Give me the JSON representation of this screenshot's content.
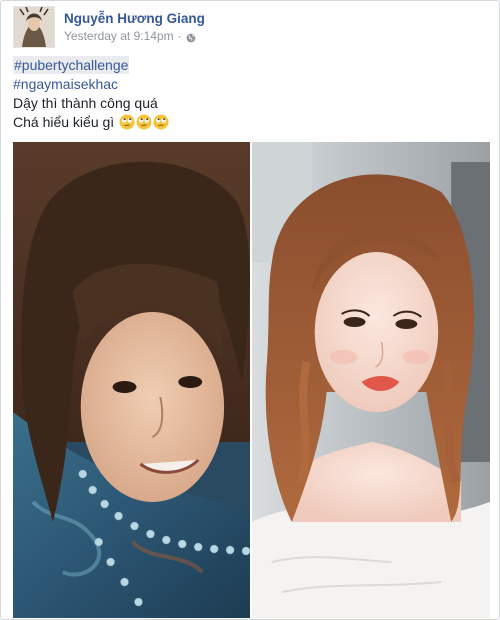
{
  "post": {
    "author_name": "Nguyễn Hương Giang",
    "timestamp": "Yesterday at 9:14pm",
    "separator": "·",
    "privacy_icon": "globe-icon",
    "hashtags": [
      "#pubertychallenge",
      "#ngaymaisekhac"
    ],
    "lines": [
      "Dậy thì thành công quá",
      "Chá hiểu kiểu gì"
    ],
    "emoji_icon": "rolling-eyes-emoji",
    "emoji_count": 3,
    "photos": [
      {
        "description_icon": "before-photo"
      },
      {
        "description_icon": "after-photo"
      }
    ]
  },
  "colors": {
    "link": "#365899",
    "text": "#1d2129",
    "meta": "#90949c",
    "hashtag_highlight": "#e9ebee"
  }
}
